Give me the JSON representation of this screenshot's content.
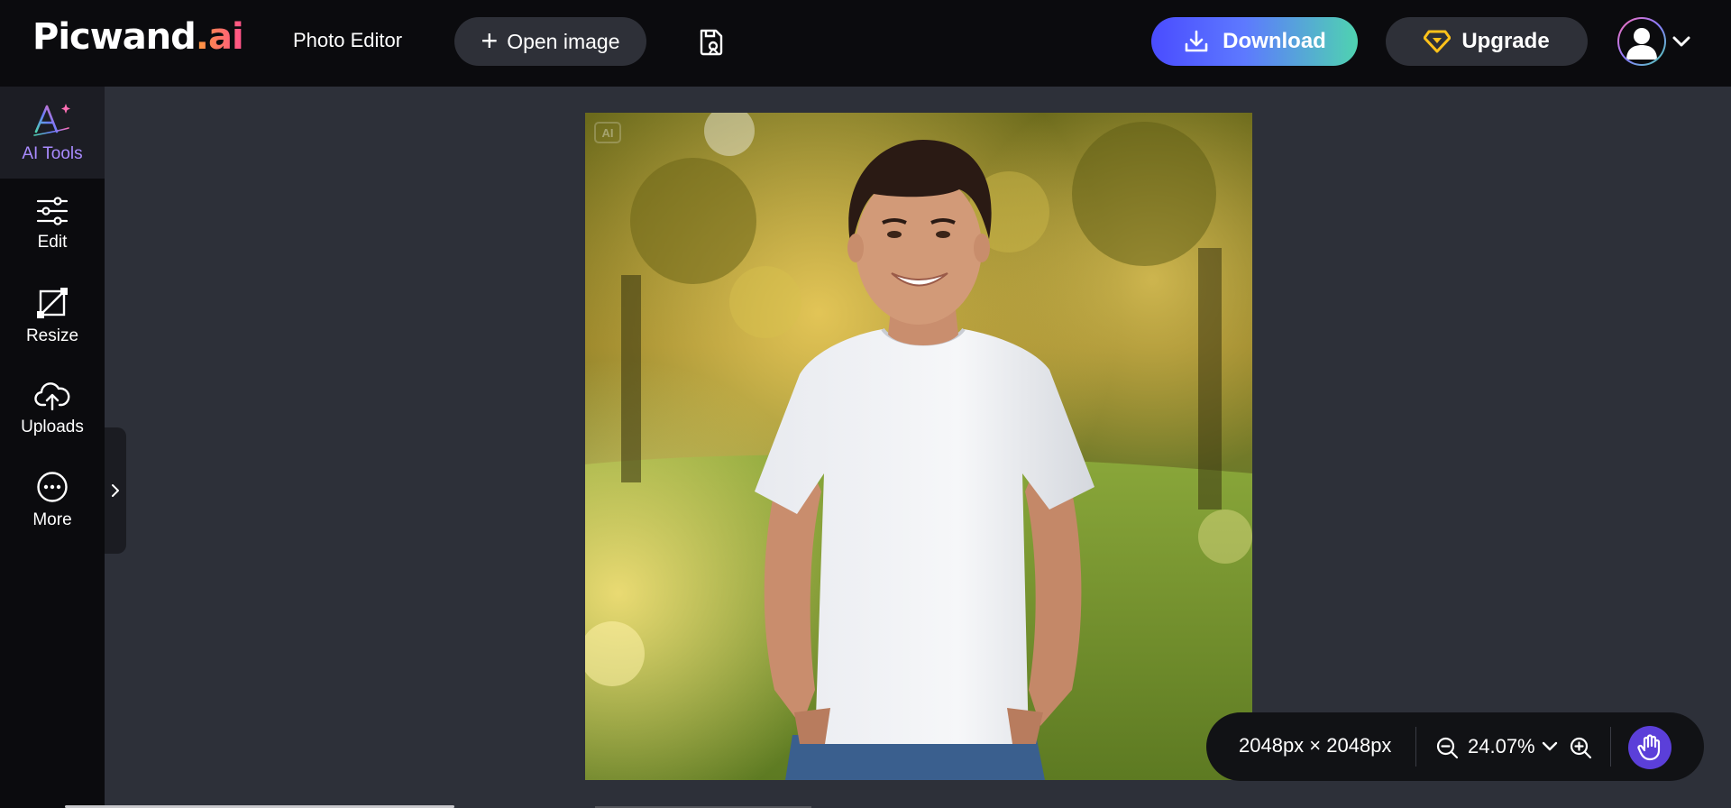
{
  "header": {
    "logo_main": "Picwand",
    "logo_suffix": ".ai",
    "app_title": "Photo Editor",
    "open_image_label": "Open image",
    "download_label": "Download",
    "upgrade_label": "Upgrade"
  },
  "sidebar": {
    "items": [
      {
        "label": "AI Tools",
        "icon": "ai-sparkle-icon",
        "active": true
      },
      {
        "label": "Edit",
        "icon": "sliders-icon",
        "active": false
      },
      {
        "label": "Resize",
        "icon": "crop-resize-icon",
        "active": false
      },
      {
        "label": "Uploads",
        "icon": "cloud-upload-icon",
        "active": false
      },
      {
        "label": "More",
        "icon": "more-dots-icon",
        "active": false
      }
    ]
  },
  "canvas": {
    "badge": "AI",
    "image_subject": "smiling teen in white t-shirt in sunlit park"
  },
  "zoombar": {
    "dimensions": "2048px × 2048px",
    "zoom": "24.07%"
  },
  "colors": {
    "accent_purple": "#a98bff",
    "download_gradient_start": "#4a4cff",
    "download_gradient_end": "#4fd3b0",
    "hand_button": "#5b3fd9",
    "topbar_bg": "#0b0b0e",
    "canvas_bg": "#2d3039"
  }
}
